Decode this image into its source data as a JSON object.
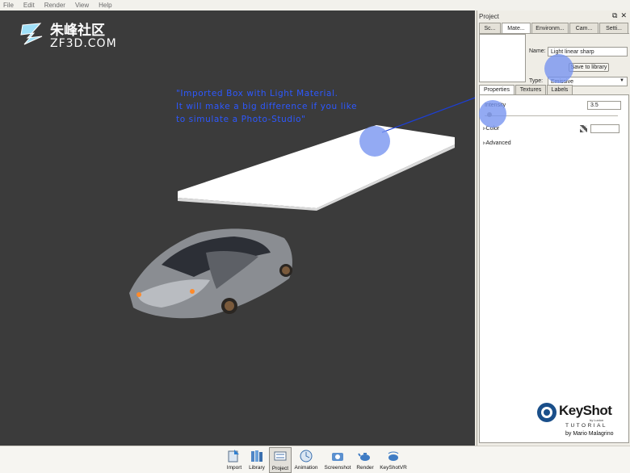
{
  "menubar": {
    "items": [
      "File",
      "Edit",
      "Render",
      "View",
      "Help"
    ]
  },
  "watermark": {
    "title": "朱峰社区",
    "subtitle": "ZF3D.COM"
  },
  "annotation": {
    "line1": "\"Imported Box with Light Material.",
    "line2": "It will make a big difference if you like",
    "line3": "to simulate a Photo-Studio\""
  },
  "panel": {
    "title": "Project",
    "tabs": [
      "Sc...",
      "Mate...",
      "Environm...",
      "Cam...",
      "Setti..."
    ],
    "active_tab": "Mate...",
    "name_label": "Name:",
    "name_value": "Light linear sharp",
    "save_button": "Save to library",
    "type_label": "Type:",
    "type_value": "Emissive",
    "sub_tabs": [
      "Properties",
      "Textures",
      "Labels"
    ],
    "active_sub_tab": "Properties",
    "intensity_label": "Intensity",
    "intensity_value": "3.5",
    "color_label": "Color",
    "advanced_label": "Advanced",
    "color_value": "#ffffff"
  },
  "branding": {
    "product": "KeyShot",
    "by": "by Luxion",
    "tutorial": "TUTORIAL",
    "author": "by Mario Malagrino"
  },
  "toolbar": {
    "items": [
      "Import",
      "Library",
      "Project",
      "Animation",
      "Screenshot",
      "Render",
      "KeyShotVR"
    ],
    "active": "Project"
  },
  "colors": {
    "viewport": "#3b3b3b",
    "highlight": "#7492f0",
    "annotation": "#2d58ff"
  }
}
